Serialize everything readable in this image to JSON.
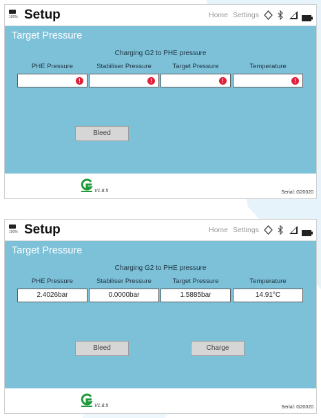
{
  "watermark_color": "#e6f3fa",
  "screens": [
    {
      "header": {
        "title": "Setup",
        "battery_label": "100%",
        "home_label": "Home",
        "settings_label": "Settings"
      },
      "panel": {
        "title": "Target Pressure",
        "subtitle": "Charging G2 to PHE pressure",
        "columns": [
          "PHE Pressure",
          "Stabiliser Pressure",
          "Target Pressure",
          "Temperature"
        ],
        "fields": [
          "",
          "",
          "",
          ""
        ],
        "fields_have_error": true,
        "bleed_label": "Bleed"
      },
      "footer": {
        "version": "V1.8.5",
        "serial": "Serial: G20020"
      }
    },
    {
      "header": {
        "title": "Setup",
        "battery_label": "100%",
        "home_label": "Home",
        "settings_label": "Settings"
      },
      "panel": {
        "title": "Target Pressure",
        "subtitle": "Charging G2 to PHE pressure",
        "columns": [
          "PHE Pressure",
          "Stabiliser Pressure",
          "Target Pressure",
          "Temperature"
        ],
        "fields": [
          "2.4026bar",
          "0.0000bar",
          "1.5885bar",
          "14.91°C"
        ],
        "fields_have_error": false,
        "bleed_label": "Bleed",
        "charge_label": "Charge"
      },
      "footer": {
        "version": "V1.8.5",
        "serial": "Serial: G20020"
      }
    }
  ],
  "colors": {
    "panel_bg": "#7dc1d9",
    "error_red": "#e0203a",
    "logo_green": "#1f9a3a"
  },
  "icons": [
    "battery-icon",
    "location-icon",
    "bluetooth-icon",
    "signal-icon",
    "error-icon",
    "logo-icon"
  ]
}
